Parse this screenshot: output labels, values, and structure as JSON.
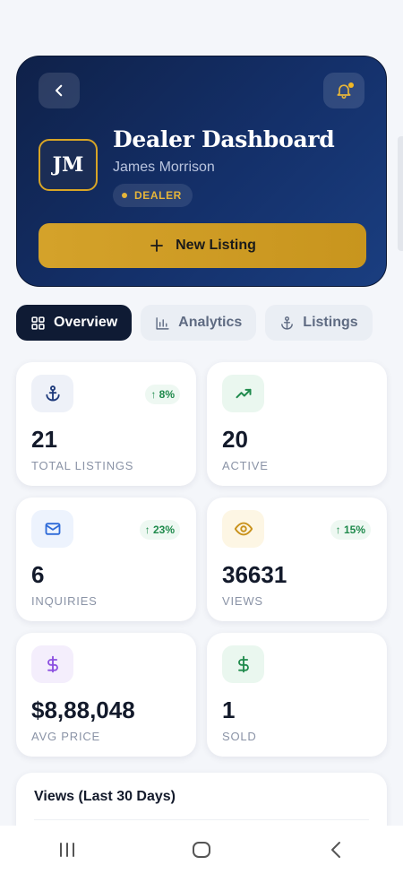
{
  "header": {
    "title": "Dealer Dashboard",
    "user_name": "James Morrison",
    "avatar_initials": "JM",
    "role_badge": "DEALER",
    "new_listing_label": "New Listing",
    "back_icon": "chevron-left-icon",
    "bell_icon": "bell-icon",
    "has_notification": true
  },
  "tabs": [
    {
      "label": "Overview",
      "icon": "grid-icon",
      "active": true
    },
    {
      "label": "Analytics",
      "icon": "bar-chart-icon",
      "active": false
    },
    {
      "label": "Listings",
      "icon": "anchor-icon",
      "active": false
    }
  ],
  "stats": [
    {
      "value": "21",
      "label": "TOTAL LISTINGS",
      "trend": "↑ 8%",
      "icon": "anchor-icon",
      "color": "#1e3a7b",
      "bg": "#eef1f8"
    },
    {
      "value": "20",
      "label": "ACTIVE",
      "trend": "",
      "icon": "trending-up-icon",
      "color": "#1f8a4c",
      "bg": "#eaf7ef"
    },
    {
      "value": "6",
      "label": "INQUIRIES",
      "trend": "↑ 23%",
      "icon": "mail-icon",
      "color": "#2f6bd8",
      "bg": "#edf3fd"
    },
    {
      "value": "36631",
      "label": "VIEWS",
      "trend": "↑ 15%",
      "icon": "eye-icon",
      "color": "#c9921c",
      "bg": "#fdf6e4"
    },
    {
      "value": "$8,88,048",
      "label": "AVG PRICE",
      "trend": "",
      "icon": "dollar-icon",
      "color": "#8b4fe0",
      "bg": "#f4eefc"
    },
    {
      "value": "1",
      "label": "SOLD",
      "trend": "",
      "icon": "dollar-icon",
      "color": "#1f8a4c",
      "bg": "#eaf7ef"
    }
  ],
  "views_section": {
    "title": "Views (Last 30 Days)"
  },
  "navbar": {
    "recents_icon": "recents-icon",
    "home_icon": "home-icon",
    "back_icon": "back-icon"
  },
  "colors": {
    "accent_gold": "#d4a22a",
    "hero_navy": "#14306a",
    "tab_active": "#0f1b34",
    "trend_green": "#1f8a4c"
  }
}
